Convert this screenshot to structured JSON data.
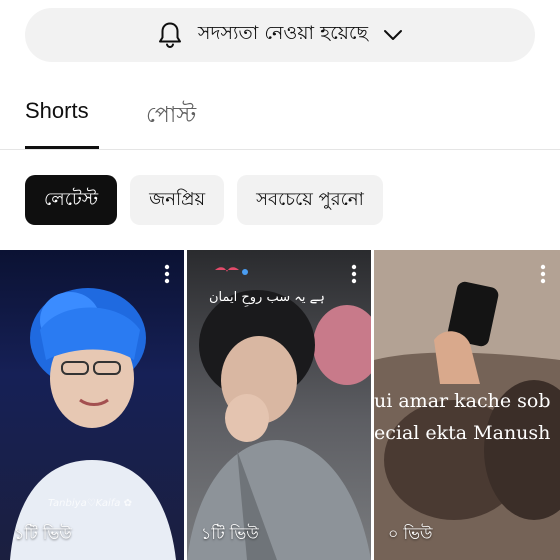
{
  "subscribe": {
    "label": "সদস্যতা নেওয়া হয়েছে",
    "bell_icon": "bell-icon",
    "chevron_icon": "chevron-down-icon"
  },
  "tabs": [
    {
      "label": "Shorts",
      "selected": true
    },
    {
      "label": "পোস্ট",
      "selected": false
    }
  ],
  "filters": [
    {
      "label": "লেটেস্ট",
      "selected": true
    },
    {
      "label": "জনপ্রিয়",
      "selected": false
    },
    {
      "label": "সবচেয়ে পুরনো",
      "selected": false
    }
  ],
  "shorts": [
    {
      "views": "১টি ভিউ",
      "watermark": "Tanbiya♡Kaifa ✿"
    },
    {
      "views": "১টি ভিউ",
      "overlay": "ہے یہ سب روحِ ایمان"
    },
    {
      "views": "০ ভিউ",
      "overlay_lines": [
        "ui amar kache sob",
        "ecial ekta Manush"
      ]
    }
  ],
  "colors": {
    "chip_active": "#0f0f0f",
    "chip": "#f2f2f2",
    "muted_text": "#606060"
  }
}
